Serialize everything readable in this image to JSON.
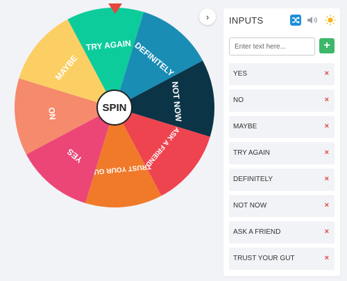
{
  "wheel": {
    "spin_label": "SPIN",
    "pointer_color": "#e3463c",
    "collapse_icon": "chevron-right-icon",
    "slices": [
      {
        "label": "DEFINITELY",
        "color": "#1a8db5"
      },
      {
        "label": "NOT NOW",
        "color": "#0b3447"
      },
      {
        "label": "ASK A FRIEND",
        "color": "#ee4450"
      },
      {
        "label": "TRUST YOUR GUT",
        "color": "#f07a2a"
      },
      {
        "label": "YES",
        "color": "#ec4677"
      },
      {
        "label": "NO",
        "color": "#f58a6c"
      },
      {
        "label": "MAYBE",
        "color": "#fbcf63"
      },
      {
        "label": "TRY AGAIN",
        "color": "#0dcc9c"
      }
    ]
  },
  "panel": {
    "title": "INPUTS",
    "icons": {
      "shuffle": "shuffle-icon",
      "sound": "speaker-icon",
      "theme": "sun-icon"
    },
    "input_placeholder": "Enter text here...",
    "add_label": "+",
    "remove_label": "×",
    "items": [
      {
        "label": "YES"
      },
      {
        "label": "NO"
      },
      {
        "label": "MAYBE"
      },
      {
        "label": "TRY AGAIN"
      },
      {
        "label": "DEFINITELY"
      },
      {
        "label": "NOT NOW"
      },
      {
        "label": "ASK A FRIEND"
      },
      {
        "label": "TRUST YOUR GUT"
      }
    ]
  }
}
